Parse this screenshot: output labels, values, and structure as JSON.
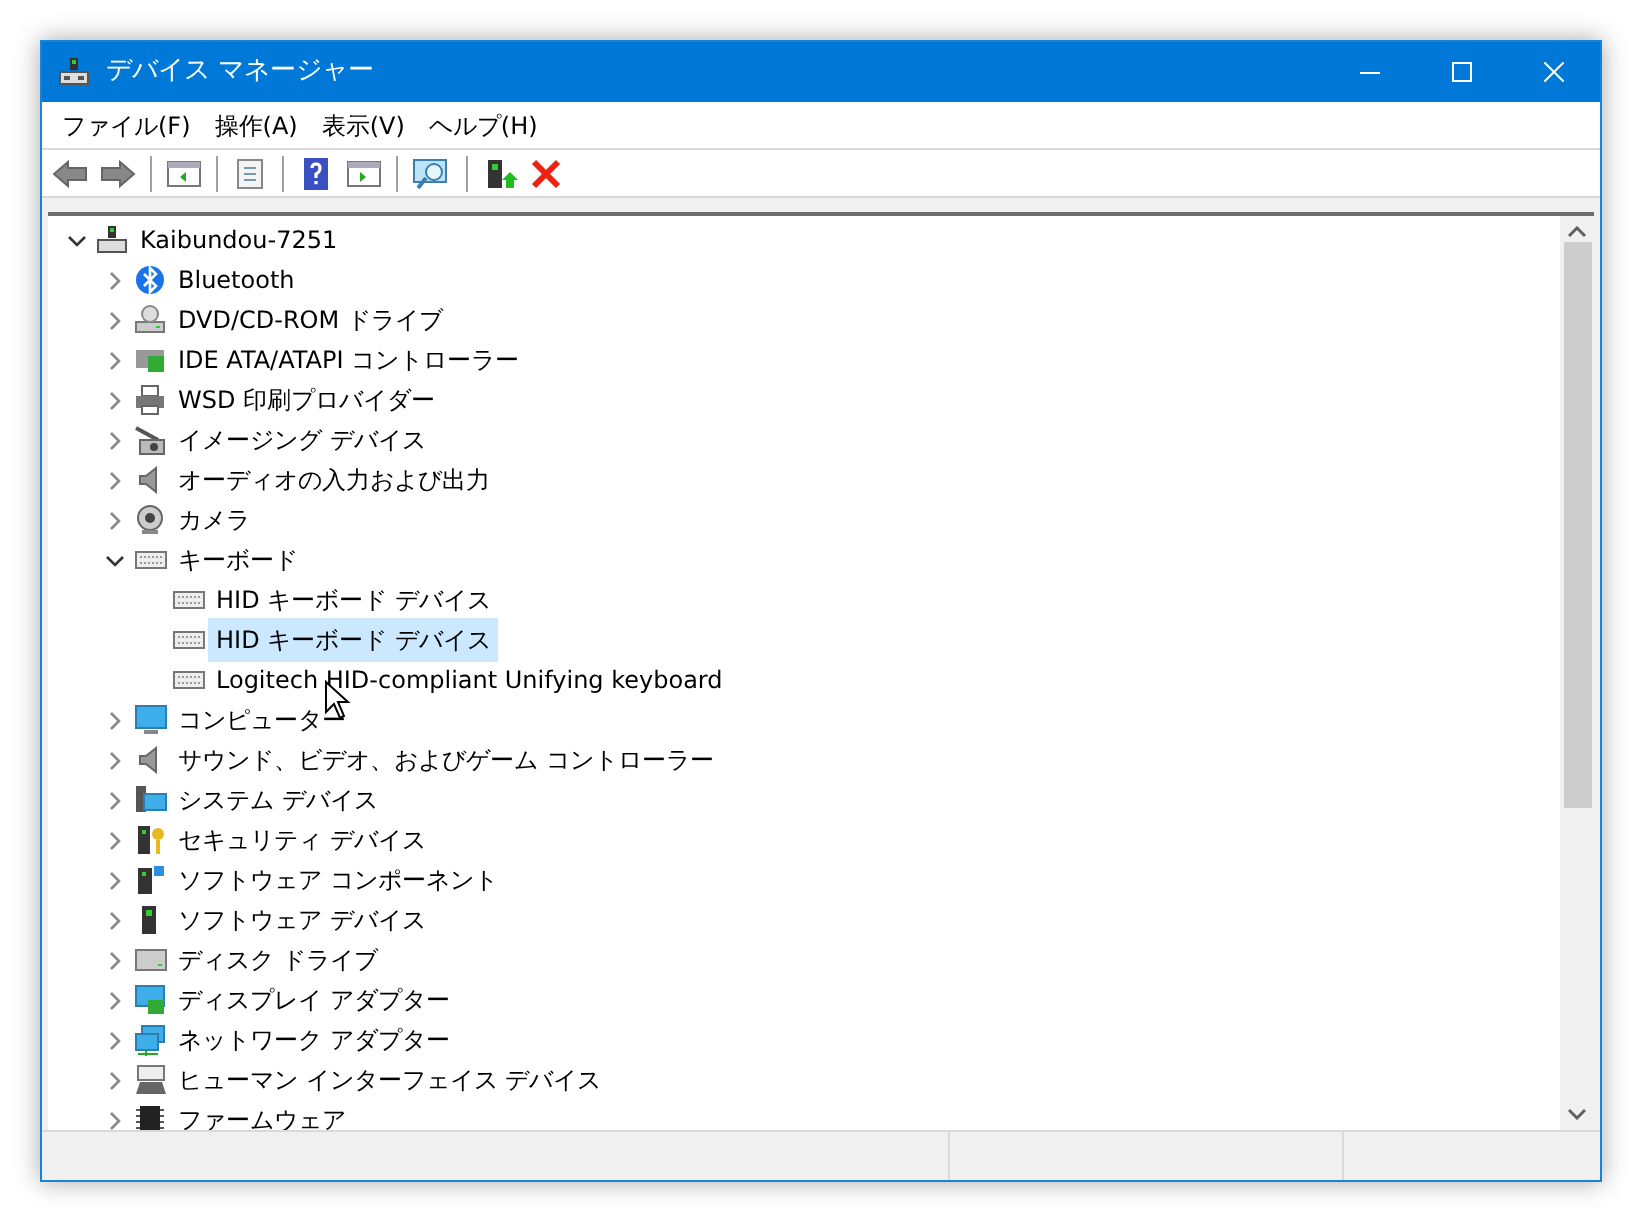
{
  "window": {
    "title": "デバイス マネージャー"
  },
  "menu": [
    "ファイル(F)",
    "操作(A)",
    "表示(V)",
    "ヘルプ(H)"
  ],
  "tree": [
    {
      "label": "Kaibundou-7251",
      "expanded": true,
      "selected": false,
      "children": [
        {
          "label": "Bluetooth",
          "expanded": false,
          "selected": false
        },
        {
          "label": "DVD/CD-ROM ドライブ",
          "expanded": false,
          "selected": false
        },
        {
          "label": "IDE ATA/ATAPI コントローラー",
          "expanded": false,
          "selected": false
        },
        {
          "label": "WSD 印刷プロバイダー",
          "expanded": false,
          "selected": false
        },
        {
          "label": "イメージング デバイス",
          "expanded": false,
          "selected": false
        },
        {
          "label": "オーディオの入力および出力",
          "expanded": false,
          "selected": false
        },
        {
          "label": "カメラ",
          "expanded": false,
          "selected": false
        },
        {
          "label": "キーボード",
          "expanded": true,
          "selected": false,
          "children": [
            {
              "label": "HID キーボード デバイス",
              "selected": false
            },
            {
              "label": "HID キーボード デバイス",
              "selected": true
            },
            {
              "label": "Logitech HID-compliant Unifying keyboard",
              "selected": false
            }
          ]
        },
        {
          "label": "コンピューター",
          "expanded": false,
          "selected": false
        },
        {
          "label": "サウンド、ビデオ、およびゲーム コントローラー",
          "expanded": false,
          "selected": false
        },
        {
          "label": "システム デバイス",
          "expanded": false,
          "selected": false
        },
        {
          "label": "セキュリティ デバイス",
          "expanded": false,
          "selected": false
        },
        {
          "label": "ソフトウェア コンポーネント",
          "expanded": false,
          "selected": false
        },
        {
          "label": "ソフトウェア デバイス",
          "expanded": false,
          "selected": false
        },
        {
          "label": "ディスク ドライブ",
          "expanded": false,
          "selected": false
        },
        {
          "label": "ディスプレイ アダプター",
          "expanded": false,
          "selected": false
        },
        {
          "label": "ネットワーク アダプター",
          "expanded": false,
          "selected": false
        },
        {
          "label": "ヒューマン インターフェイス デバイス",
          "expanded": false,
          "selected": false
        },
        {
          "label": "ファームウェア",
          "expanded": false,
          "selected": false
        }
      ]
    }
  ]
}
